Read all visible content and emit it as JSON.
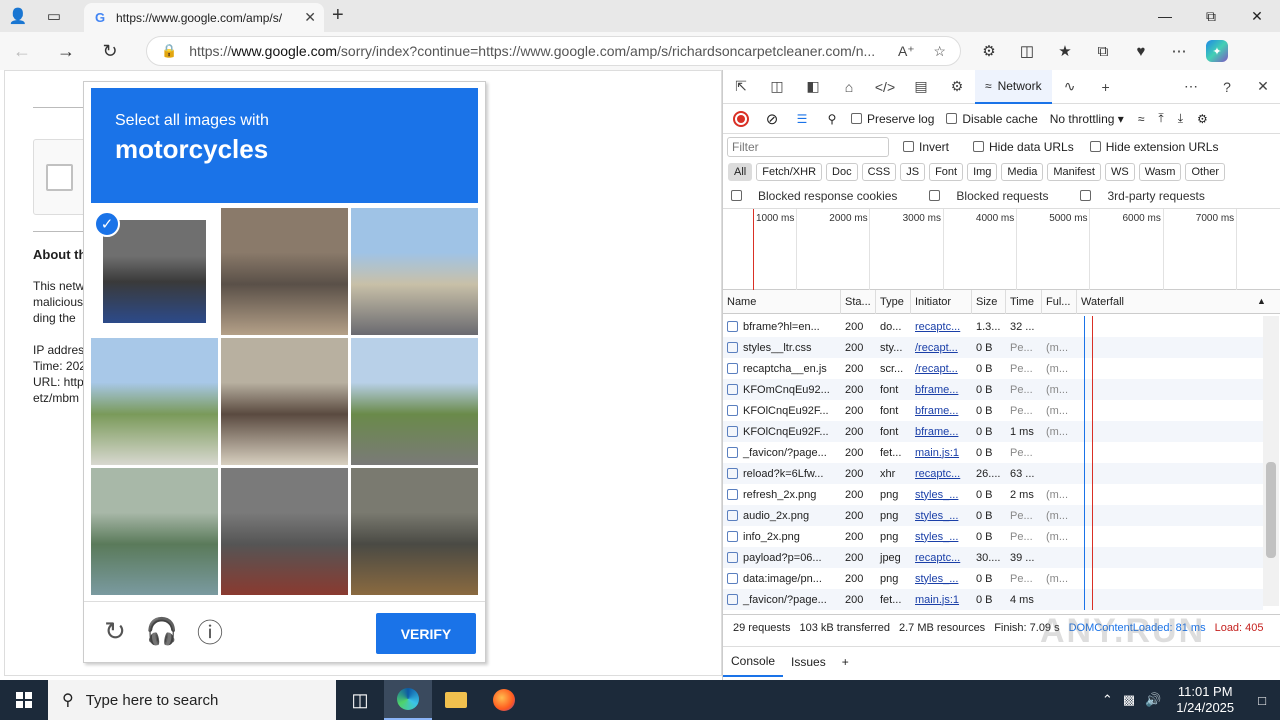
{
  "browser": {
    "tab_title": "https://www.google.com/amp/s/",
    "url_prefix": "https://",
    "url_host": "www.google.com",
    "url_rest": "/sorry/index?continue=https://www.google.com/amp/s/richardsoncarpetcleaner.com/n..."
  },
  "page": {
    "heading": "About th",
    "lines": [
      "This netw",
      "malicious",
      "ding the",
      "",
      "IP addres",
      "Time: 202",
      "URL: http",
      "etz/mbm"
    ]
  },
  "captcha": {
    "prompt_line1": "Select all images with",
    "prompt_line2": "motorcycles",
    "verify_label": "VERIFY",
    "tiles": [
      {
        "selected": true,
        "colors": [
          "#6f6f6f",
          "#3a3a3a",
          "#2c4a8a"
        ]
      },
      {
        "selected": false,
        "colors": [
          "#8a7a6a",
          "#5a5048",
          "#b4a088"
        ]
      },
      {
        "selected": false,
        "colors": [
          "#9fc3e6",
          "#c8c0a8",
          "#6a6a70"
        ]
      },
      {
        "selected": false,
        "colors": [
          "#a8c8e8",
          "#7a9a5a",
          "#d8d8d0"
        ]
      },
      {
        "selected": false,
        "colors": [
          "#b8b0a0",
          "#5a4a40",
          "#d8d0c0"
        ]
      },
      {
        "selected": false,
        "colors": [
          "#b8d0e8",
          "#6a8a4a",
          "#7a7a78"
        ]
      },
      {
        "selected": false,
        "colors": [
          "#a8b8a8",
          "#5a7a5a",
          "#7a9aa0"
        ]
      },
      {
        "selected": false,
        "colors": [
          "#7a7a7a",
          "#555555",
          "#8a3a30"
        ]
      },
      {
        "selected": false,
        "colors": [
          "#7a7a70",
          "#4a4a44",
          "#8a6a40"
        ]
      }
    ]
  },
  "devtools": {
    "network_tab": "Network",
    "preserve_log": "Preserve log",
    "disable_cache": "Disable cache",
    "throttling": "No throttling",
    "filter_placeholder": "Filter",
    "invert": "Invert",
    "hide_data_urls": "Hide data URLs",
    "hide_ext_urls": "Hide extension URLs",
    "type_filters": [
      "All",
      "Fetch/XHR",
      "Doc",
      "CSS",
      "JS",
      "Font",
      "Img",
      "Media",
      "Manifest",
      "WS",
      "Wasm",
      "Other"
    ],
    "blocked_cookies": "Blocked response cookies",
    "blocked_requests": "Blocked requests",
    "third_party": "3rd-party requests",
    "timeline_labels": [
      "1000 ms",
      "2000 ms",
      "3000 ms",
      "4000 ms",
      "5000 ms",
      "6000 ms",
      "7000 ms"
    ],
    "columns": [
      "Name",
      "Sta...",
      "Type",
      "Initiator",
      "Size",
      "Time",
      "Ful...",
      "Waterfall"
    ],
    "rows": [
      [
        "bframe?hl=en...",
        "200",
        "do...",
        "recaptc...",
        "1.3...",
        "32 ...",
        ""
      ],
      [
        "styles__ltr.css",
        "200",
        "sty...",
        "/recapt...",
        "0 B",
        "Pe...",
        "(m..."
      ],
      [
        "recaptcha__en.js",
        "200",
        "scr...",
        "/recapt...",
        "0 B",
        "Pe...",
        "(m..."
      ],
      [
        "KFOmCnqEu92...",
        "200",
        "font",
        "bframe...",
        "0 B",
        "Pe...",
        "(m..."
      ],
      [
        "KFOlCnqEu92F...",
        "200",
        "font",
        "bframe...",
        "0 B",
        "Pe...",
        "(m..."
      ],
      [
        "KFOlCnqEu92F...",
        "200",
        "font",
        "bframe...",
        "0 B",
        "1 ms",
        "(m..."
      ],
      [
        "_favicon/?page...",
        "200",
        "fet...",
        "main.js:1",
        "0 B",
        "Pe...",
        ""
      ],
      [
        "reload?k=6Lfw...",
        "200",
        "xhr",
        "recaptc...",
        "26....",
        "63 ...",
        ""
      ],
      [
        "refresh_2x.png",
        "200",
        "png",
        "styles_...",
        "0 B",
        "2 ms",
        "(m..."
      ],
      [
        "audio_2x.png",
        "200",
        "png",
        "styles_...",
        "0 B",
        "Pe...",
        "(m..."
      ],
      [
        "info_2x.png",
        "200",
        "png",
        "styles_...",
        "0 B",
        "Pe...",
        "(m..."
      ],
      [
        "payload?p=06...",
        "200",
        "jpeg",
        "recaptc...",
        "30....",
        "39 ...",
        ""
      ],
      [
        "data:image/pn...",
        "200",
        "png",
        "styles_...",
        "0 B",
        "Pe...",
        "(m..."
      ],
      [
        "_favicon/?page...",
        "200",
        "fet...",
        "main.js:1",
        "0 B",
        "4 ms",
        ""
      ]
    ],
    "status_requests": "29 requests",
    "status_transferred": "103 kB transferred",
    "status_resources": "2.7 MB resources",
    "status_finish": "Finish: 7.09 s",
    "status_dcl": "DOMContentLoaded: 81 ms",
    "status_load": "Load: 405",
    "drawer_console": "Console",
    "drawer_issues": "Issues"
  },
  "taskbar": {
    "search_placeholder": "Type here to search",
    "time": "11:01 PM",
    "date": "1/24/2025"
  },
  "watermark": "ANY.RUN"
}
